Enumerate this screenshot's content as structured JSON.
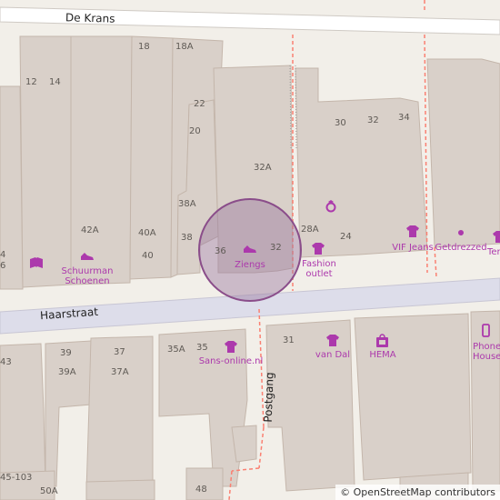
{
  "streets": {
    "de_krans": "De Krans",
    "haarstraat": "Haarstraat",
    "postgang": "Postgang"
  },
  "house_numbers": {
    "n18": "18",
    "n18a": "18A",
    "n12": "12",
    "n14": "14",
    "n22": "22",
    "n20": "20",
    "n30": "30",
    "n32": "32",
    "n34": "34",
    "n32a": "32A",
    "n38a": "38A",
    "n38": "38",
    "n42a": "42A",
    "n40a": "40A",
    "n40": "40",
    "n36": "36",
    "n32b": "32",
    "n28a": "28A",
    "n24": "24",
    "n4": "4",
    "n6": "6",
    "n43": "43",
    "n39": "39",
    "n37": "37",
    "n39a": "39A",
    "n37a": "37A",
    "n35a": "35A",
    "n35": "35",
    "n31": "31",
    "n45_103": "45-103",
    "n50a": "50A",
    "n48": "48"
  },
  "pois": {
    "schuurman_schoenen": "Schuurman\nSchoenen",
    "ziengs": "Ziengs",
    "fashion_outlet": "Fashion\noutlet",
    "vif_jeans": "VIF Jeans",
    "getdrezzed": "Getdrezzed",
    "ter": "Ter",
    "sans_online": "Sans-online.nl",
    "van_dal": "van Dal",
    "hema": "HEMA",
    "phone_house": "Phone\nHouse"
  },
  "map": {
    "highlight_color": "#9c7ba0",
    "poi_color": "#ac39ac",
    "building_color": "#d9d0c9",
    "footway_color": "#fa8072"
  },
  "attribution": "© OpenStreetMap contributors"
}
